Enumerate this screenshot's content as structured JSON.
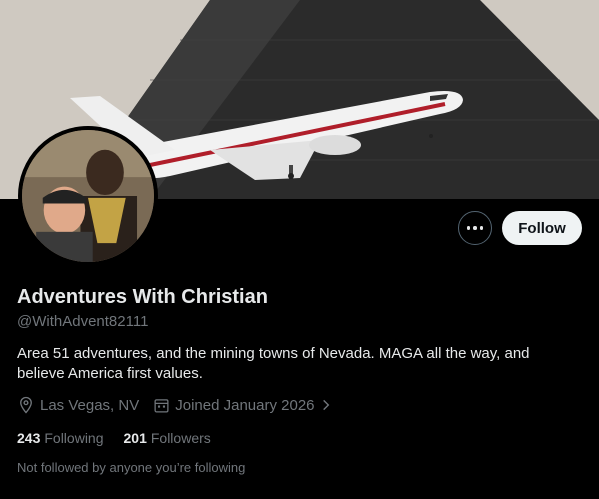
{
  "profile": {
    "display_name": "Adventures With Christian",
    "handle": "@WithAdvent82111",
    "bio": "Area 51 adventures, and the mining towns of Nevada. MAGA all the way, and believe America first values.",
    "location": "Las Vegas, NV",
    "joined": "Joined January 2026",
    "following_count": "243",
    "following_label": "Following",
    "followers_count": "201",
    "followers_label": "Followers",
    "not_followed_text": "Not followed by anyone you’re following"
  },
  "actions": {
    "follow_label": "Follow",
    "more_icon": "more-dots-icon"
  },
  "colors": {
    "background": "#000000",
    "primary_text": "#e7e9ea",
    "secondary_text": "#71767b",
    "follow_button_bg": "#eff3f4",
    "follow_button_text": "#0f1419",
    "border": "#536471"
  }
}
